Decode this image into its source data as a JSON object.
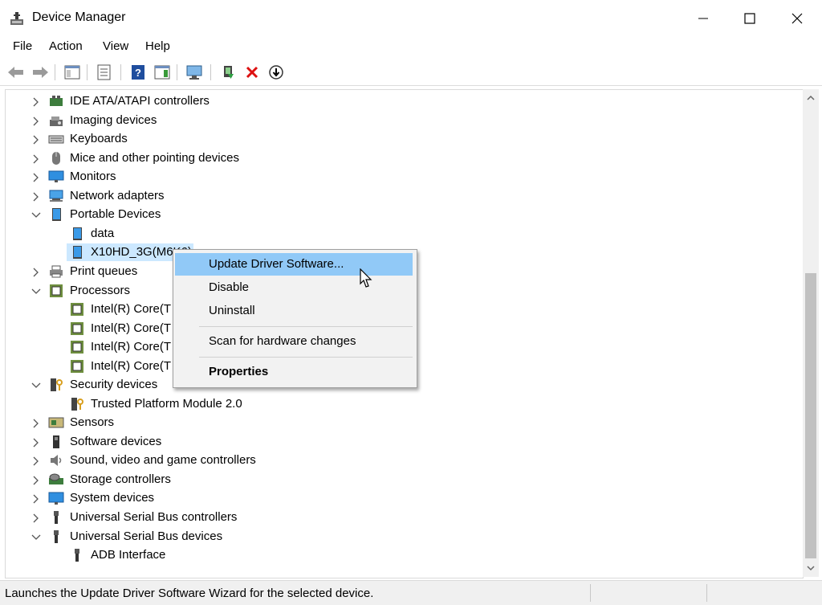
{
  "window": {
    "title": "Device Manager",
    "controls": [
      "minimize",
      "maximize",
      "close"
    ]
  },
  "menu": [
    "File",
    "Action",
    "View",
    "Help"
  ],
  "toolbar": {
    "buttons": [
      "back-icon",
      "forward-icon",
      "show-hide-console-tree-icon",
      "properties-icon",
      "help-icon",
      "action-pane-icon",
      "scan-hardware-icon",
      "update-driver-icon",
      "uninstall-icon",
      "disable-icon"
    ]
  },
  "tree": {
    "categories": {
      "ide": "IDE ATA/ATAPI controllers",
      "imaging": "Imaging devices",
      "keyboards": "Keyboards",
      "mice": "Mice and other pointing devices",
      "monitors": "Monitors",
      "network": "Network adapters",
      "portable": "Portable Devices",
      "print": "Print queues",
      "processors": "Processors",
      "security": "Security devices",
      "sensors": "Sensors",
      "software": "Software devices",
      "sound": "Sound, video and game controllers",
      "storage": "Storage controllers",
      "system": "System devices",
      "usb_controllers": "Universal Serial Bus controllers",
      "usb_devices": "Universal Serial Bus devices"
    },
    "portable_children": [
      "data",
      "X10HD_3G(M6K6)"
    ],
    "processor_children": [
      "Intel(R) Core(T",
      "Intel(R) Core(T",
      "Intel(R) Core(T",
      "Intel(R) Core(T"
    ],
    "security_children": [
      "Trusted Platform Module 2.0"
    ],
    "usb_devices_children": [
      "ADB Interface"
    ]
  },
  "context_menu": {
    "items": [
      "Update Driver Software...",
      "Disable",
      "Uninstall",
      "Scan for hardware changes",
      "Properties"
    ],
    "highlight_color": "#91c9f7"
  },
  "status": {
    "text": "Launches the Update Driver Software Wizard for the selected device."
  },
  "colors": {
    "selection": "#cce8ff",
    "accent": "#0078d7"
  }
}
